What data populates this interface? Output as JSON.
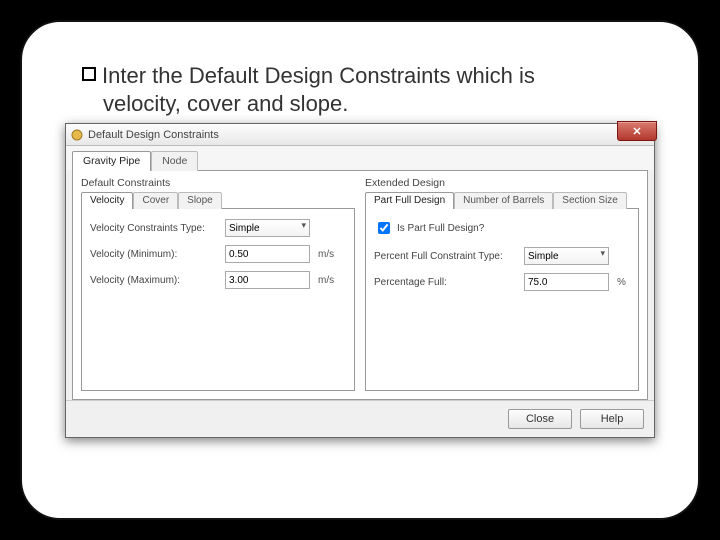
{
  "bullet_text_1": "Inter the Default Design Constraints which is",
  "bullet_text_2": "velocity, cover and slope.",
  "dialog": {
    "title": "Default Design Constraints",
    "tabs": {
      "gravity": "Gravity Pipe",
      "node": "Node"
    },
    "left": {
      "group": "Default Constraints",
      "subtabs": {
        "velocity": "Velocity",
        "cover": "Cover",
        "slope": "Slope"
      },
      "row1_label": "Velocity Constraints Type:",
      "row1_value": "Simple",
      "row2_label": "Velocity (Minimum):",
      "row2_value": "0.50",
      "row2_unit": "m/s",
      "row3_label": "Velocity (Maximum):",
      "row3_value": "3.00",
      "row3_unit": "m/s"
    },
    "right": {
      "group": "Extended Design",
      "subtabs": {
        "pfd": "Part Full Design",
        "nb": "Number of Barrels",
        "ss": "Section Size"
      },
      "check_label": "Is Part Full Design?",
      "row1_label": "Percent Full Constraint Type:",
      "row1_value": "Simple",
      "row2_label": "Percentage Full:",
      "row2_value": "75.0",
      "row2_unit": "%"
    },
    "buttons": {
      "close": "Close",
      "help": "Help"
    }
  }
}
